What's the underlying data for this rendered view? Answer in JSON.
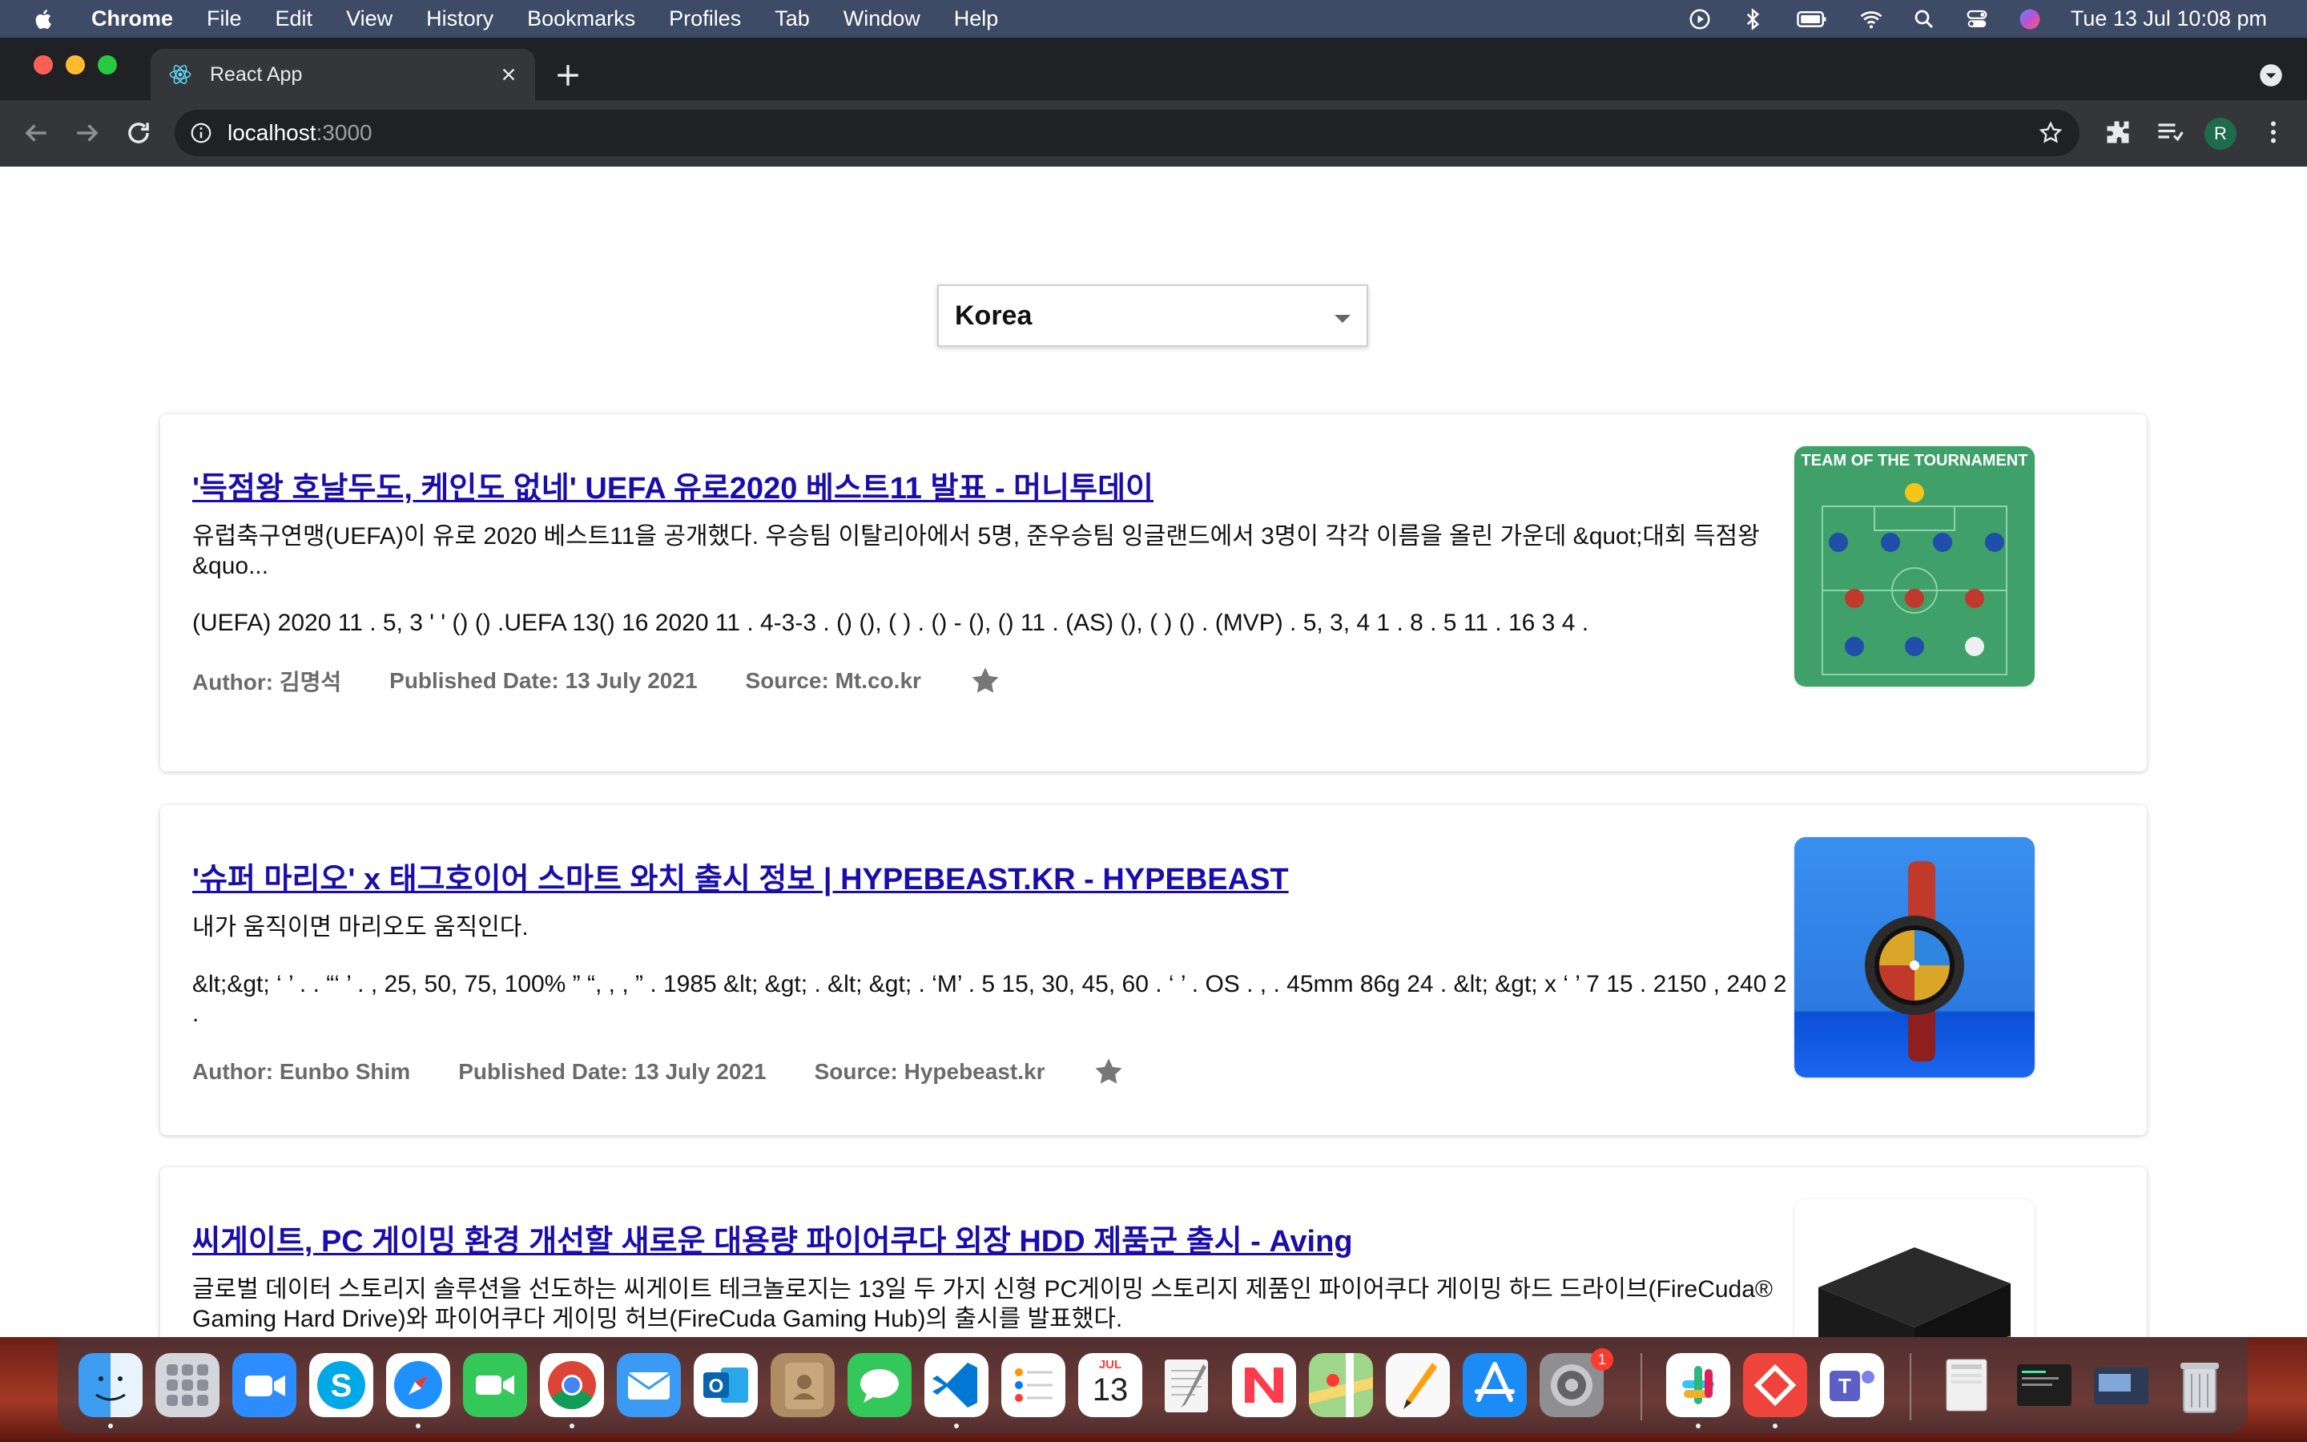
{
  "menubar": {
    "app_name": "Chrome",
    "items": [
      "File",
      "Edit",
      "View",
      "History",
      "Bookmarks",
      "Profiles",
      "Tab",
      "Window",
      "Help"
    ],
    "clock": "Tue 13 Jul  10:08 pm",
    "status_icons": [
      "play-circle-icon",
      "bluetooth-icon",
      "battery-icon",
      "wifi-icon",
      "spotlight-search-icon",
      "control-center-icon",
      "siri-icon"
    ]
  },
  "browser": {
    "tab_title": "React App",
    "url_host": "localhost",
    "url_port": ":3000",
    "profile_initial": "R"
  },
  "page": {
    "country_select": {
      "value": "Korea"
    },
    "articles": [
      {
        "title": "'득점왕 호날두도, 케인도 없네' UEFA 유로2020 베스트11 발표 - 머니투데이",
        "description": "유럽축구연맹(UEFA)이 유로 2020 베스트11을 공개했다. 우승팀 이탈리아에서 5명, 준우승팀 잉글랜드에서 3명이 각각 이름을 올린 가운데 &quot;대회 득점왕&quo...",
        "content": "(UEFA) 2020 11 . 5, 3 ' ' () () .UEFA 13() 16 2020 11 . 4-3-3 . () (), ( ) . () - (), () 11 . (AS) (), ( ) () . (MVP) . 5, 3, 4 1 . 8 . 5 11 . 16 3 4 .",
        "author": "Author: 김명석",
        "published": "Published Date: 13 July 2021",
        "source": "Source: Mt.co.kr",
        "thumb_caption": "TEAM OF THE TOURNAMENT"
      },
      {
        "title": "'슈퍼 마리오' x 태그호이어 스마트 와치 출시 정보 | HYPEBEAST.KR - HYPEBEAST",
        "description": "내가 움직이면 마리오도 움직인다.",
        "content": "&lt;&gt; ‘ ’ . . “‘ ’ . , 25, 50, 75, 100% ” “, , , ” . 1985 &lt; &gt; . &lt; &gt; . ‘M’ . 5 15, 30, 45, 60 . ‘ ’ . OS . , . 45mm 86g 24 . &lt; &gt; x ‘ ’ 7 15 . 2150 , 240 2 .",
        "author": "Author: Eunbo Shim",
        "published": "Published Date: 13 July 2021",
        "source": "Source: Hypebeast.kr"
      },
      {
        "title": "씨게이트, PC 게이밍 환경 개선할 새로운 대용량 파이어쿠다 외장 HDD 제품군 출시 - Aving",
        "description": "글로벌 데이터 스토리지 솔루션을 선도하는 씨게이트 테크놀로지는 13일 두 가지 신형 PC게이밍 스토리지 제품인 파이어쿠다 게이밍 하드 드라이브(FireCuda® Gaming Hard Drive)와 파이어쿠다 게이밍 허브(FireCuda Gaming Hub)의 출시를 발표했다."
      }
    ]
  },
  "dock": {
    "calendar_month": "JUL",
    "calendar_day": "13",
    "badge_count": "1",
    "apps": [
      "finder",
      "launchpad",
      "zoom",
      "skype",
      "safari",
      "facetime",
      "chrome",
      "mail",
      "outlook",
      "contacts",
      "messages",
      "vscode",
      "reminders",
      "calendar",
      "textedit",
      "news",
      "maps",
      "pages",
      "app-store",
      "system-preferences",
      "slack",
      "anydesk",
      "teams",
      "files",
      "screen",
      "window",
      "trash"
    ]
  }
}
